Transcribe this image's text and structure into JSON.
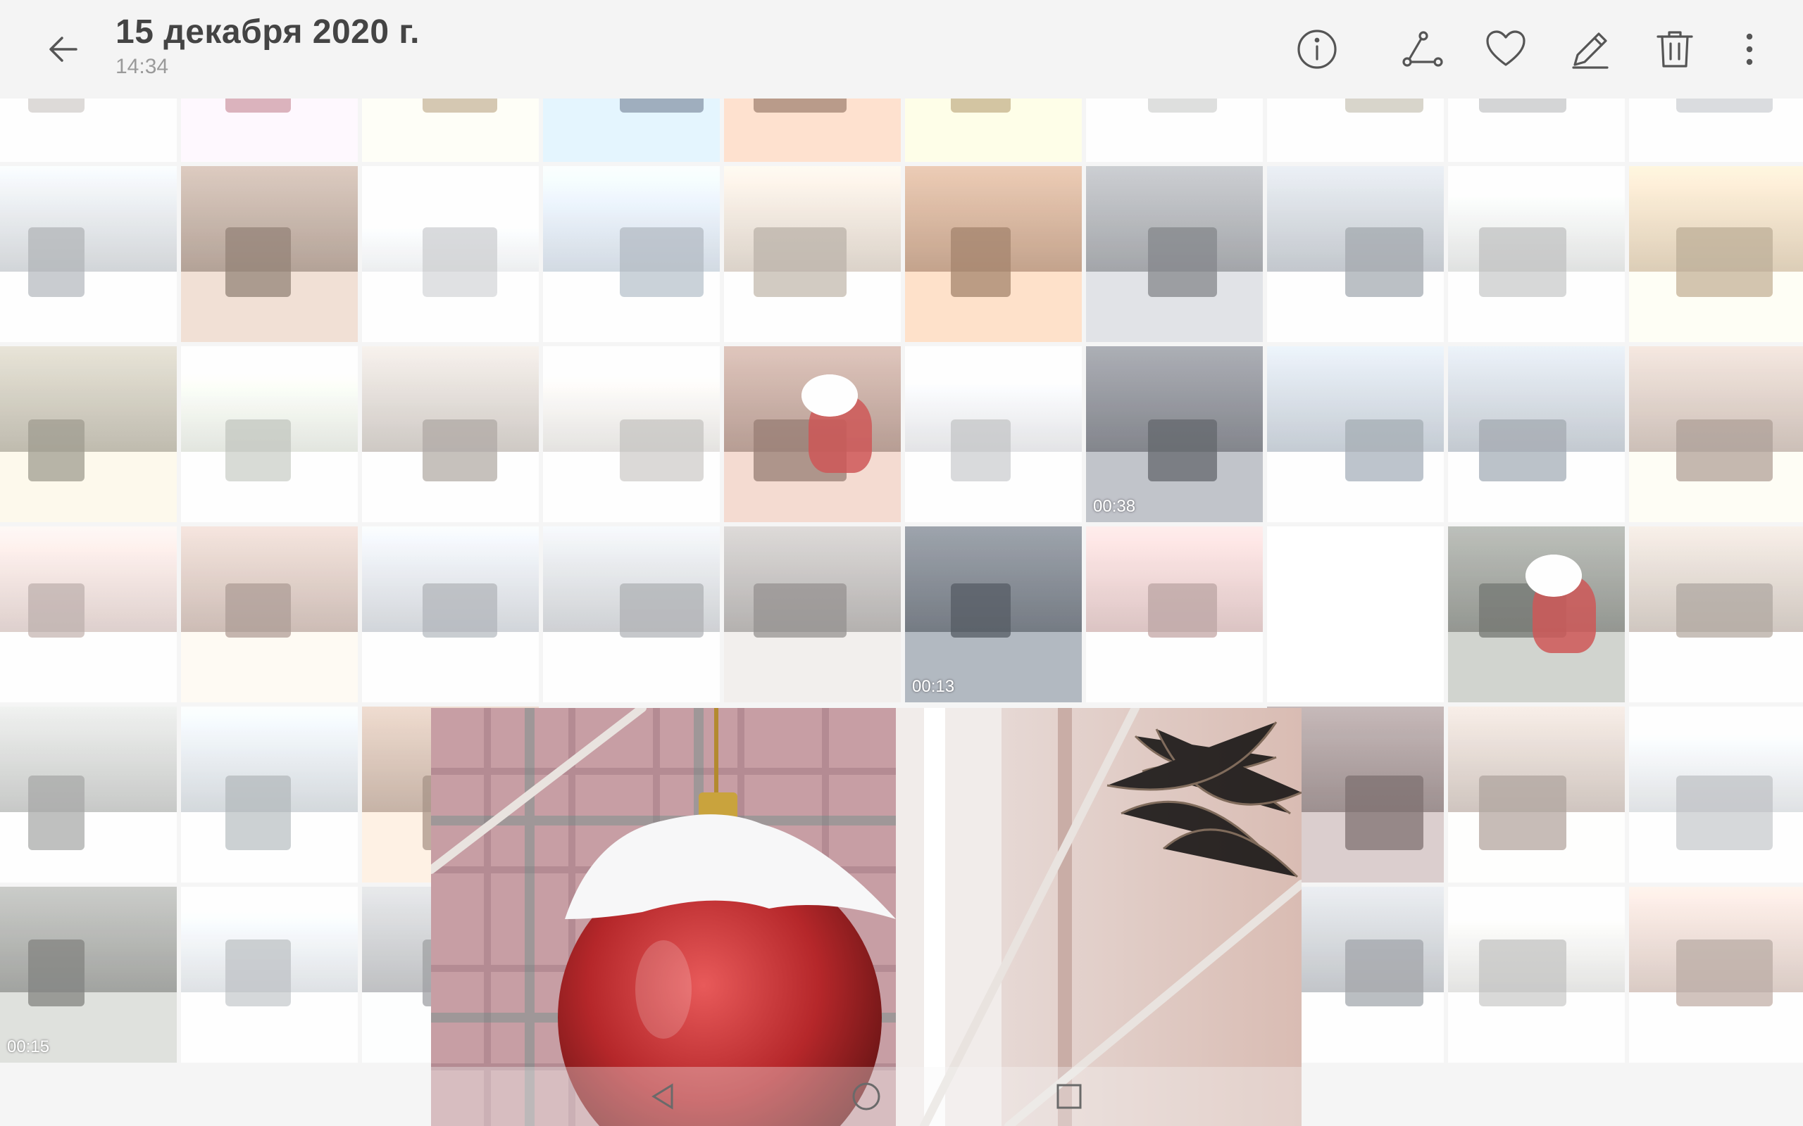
{
  "header": {
    "title": "15 декабря 2020 г.",
    "time": "14:34",
    "actions": [
      "info-icon",
      "share-icon",
      "favorite-icon",
      "edit-icon",
      "delete-icon",
      "more-icon"
    ]
  },
  "grid": {
    "rows": [
      [
        {
          "name": "snowy-path",
          "tone": "#cfcac6"
        },
        {
          "name": "pink-flower",
          "tone": "#d9a0ad"
        },
        {
          "name": "christmas-tree-sand",
          "tone": "#c9b79a"
        },
        {
          "name": "street-night",
          "tone": "#8aa0b3"
        },
        {
          "name": "brick-wall",
          "tone": "#b08a73"
        },
        {
          "name": "gold-decor",
          "tone": "#c8b487"
        },
        {
          "name": "snowy-branch",
          "tone": "#cfd1d0"
        },
        {
          "name": "garden-snow",
          "tone": "#c9c4b8"
        },
        {
          "name": "church-front",
          "tone": "#c2c3c6"
        },
        {
          "name": "white-building",
          "tone": "#c9cdd2"
        }
      ],
      [
        {
          "name": "gold-star-tree",
          "tone": "#b8bcc0"
        },
        {
          "name": "ferris-wheel",
          "tone": "#a08a7c"
        },
        {
          "name": "cranes-field",
          "tone": "#d2d4d6"
        },
        {
          "name": "white-church",
          "tone": "#b7c1cc"
        },
        {
          "name": "playground",
          "tone": "#c4b9ad"
        },
        {
          "name": "pampas-grass",
          "tone": "#b48a6d"
        },
        {
          "name": "dark-church",
          "tone": "#8b8e93"
        },
        {
          "name": "church-distance",
          "tone": "#a9afb6"
        },
        {
          "name": "colonnade-tree",
          "tone": "#c6c8c7"
        },
        {
          "name": "gold-bow",
          "tone": "#c7b497"
        }
      ],
      [
        {
          "name": "pine-buildings",
          "tone": "#a8a393"
        },
        {
          "name": "snowy-pine",
          "tone": "#c8ccc4"
        },
        {
          "name": "tent-snowfield",
          "tone": "#b7b0aa"
        },
        {
          "name": "snow-field",
          "tone": "#cbc9c6"
        },
        {
          "name": "santa-hat",
          "tone": "#a58478",
          "accent": "#d33b3b"
        },
        {
          "name": "cranes-road",
          "tone": "#c9cacd"
        },
        {
          "name": "station-night",
          "tone": "#6c6f78",
          "duration": "00:38"
        },
        {
          "name": "church-close",
          "tone": "#aab3bd"
        },
        {
          "name": "church-far",
          "tone": "#a9b1ba"
        },
        {
          "name": "big-tree-building",
          "tone": "#b7a69c"
        }
      ],
      [
        {
          "name": "pink-castle",
          "tone": "#c8b6b2"
        },
        {
          "name": "decorated-house",
          "tone": "#b8a39a"
        },
        {
          "name": "tall-tree",
          "tone": "#b8bcc2"
        },
        {
          "name": "parking-gate",
          "tone": "#b5b8bc"
        },
        {
          "name": "shop-trees",
          "tone": "#9d9997"
        },
        {
          "name": "night-shop",
          "tone": "#5d6570",
          "duration": "00:13"
        },
        {
          "name": "pink-flowers-shelf",
          "tone": "#c8aaa9"
        },
        {
          "name": "empty",
          "tone": "#ffffff"
        },
        {
          "name": "chalkboard-hat",
          "tone": "#7c8079",
          "accent": "#d33b3b"
        },
        {
          "name": "mall-interior",
          "tone": "#b9aea5"
        }
      ],
      [
        {
          "name": "wooden-church",
          "tone": "#aeb0ae"
        },
        {
          "name": "tree-square",
          "tone": "#b9bfc4"
        },
        {
          "name": "apartments",
          "tone": "#b39a8a"
        },
        null,
        null,
        null,
        null,
        {
          "name": "fix-price-shop",
          "tone": "#897878"
        },
        {
          "name": "arch-park",
          "tone": "#b9aca4"
        },
        {
          "name": "lake-fence",
          "tone": "#c5c8cb"
        }
      ],
      [
        {
          "name": "river-ducks",
          "tone": "#8a8c88",
          "duration": "00:15"
        },
        {
          "name": "tree-lot",
          "tone": "#c4c8cc"
        },
        {
          "name": "roof-edge",
          "tone": "#a6a8ab"
        },
        null,
        null,
        null,
        null,
        {
          "name": "grey-building",
          "tone": "#a9adb2"
        },
        {
          "name": "rotunda",
          "tone": "#c9c9c7"
        },
        {
          "name": "park-tower",
          "tone": "#c4b1a9"
        }
      ]
    ]
  },
  "preview": {
    "subject": "red-ornament",
    "tone": "#b85b57"
  },
  "navbar": {
    "buttons": [
      "back-nav-icon",
      "home-nav-icon",
      "recent-nav-icon"
    ]
  }
}
